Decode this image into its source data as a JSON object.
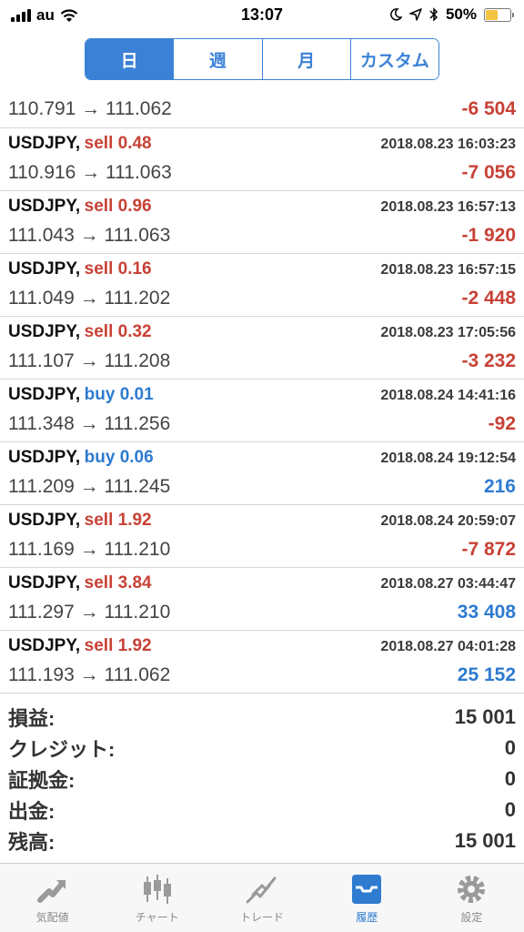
{
  "status_bar": {
    "carrier": "au",
    "time": "13:07",
    "battery_percent": "50%",
    "battery_level": 0.5,
    "colors": {
      "battery": "#f4c542"
    }
  },
  "period_tabs": [
    {
      "label": "日",
      "active": true
    },
    {
      "label": "週",
      "active": false
    },
    {
      "label": "月",
      "active": false
    },
    {
      "label": "カスタム",
      "active": false
    }
  ],
  "partial_row": {
    "prices": "110.791 → 111.062",
    "profit": "-6 504"
  },
  "trades": [
    {
      "symbol": "USDJPY,",
      "side": "sell 0.48",
      "type": "sell",
      "time": "2018.08.23 16:03:23",
      "prices": "110.916 → 111.063",
      "profit": "-7 056",
      "profit_sign": "neg"
    },
    {
      "symbol": "USDJPY,",
      "side": "sell 0.96",
      "type": "sell",
      "time": "2018.08.23 16:57:13",
      "prices": "111.043 → 111.063",
      "profit": "-1 920",
      "profit_sign": "neg"
    },
    {
      "symbol": "USDJPY,",
      "side": "sell 0.16",
      "type": "sell",
      "time": "2018.08.23 16:57:15",
      "prices": "111.049 → 111.202",
      "profit": "-2 448",
      "profit_sign": "neg"
    },
    {
      "symbol": "USDJPY,",
      "side": "sell 0.32",
      "type": "sell",
      "time": "2018.08.23 17:05:56",
      "prices": "111.107 → 111.208",
      "profit": "-3 232",
      "profit_sign": "neg"
    },
    {
      "symbol": "USDJPY,",
      "side": "buy 0.01",
      "type": "buy",
      "time": "2018.08.24 14:41:16",
      "prices": "111.348 → 111.256",
      "profit": "-92",
      "profit_sign": "neg"
    },
    {
      "symbol": "USDJPY,",
      "side": "buy 0.06",
      "type": "buy",
      "time": "2018.08.24 19:12:54",
      "prices": "111.209 → 111.245",
      "profit": "216",
      "profit_sign": "pos"
    },
    {
      "symbol": "USDJPY,",
      "side": "sell 1.92",
      "type": "sell",
      "time": "2018.08.24 20:59:07",
      "prices": "111.169 → 111.210",
      "profit": "-7 872",
      "profit_sign": "neg"
    },
    {
      "symbol": "USDJPY,",
      "side": "sell 3.84",
      "type": "sell",
      "time": "2018.08.27 03:44:47",
      "prices": "111.297 → 111.210",
      "profit": "33 408",
      "profit_sign": "pos"
    },
    {
      "symbol": "USDJPY,",
      "side": "sell 1.92",
      "type": "sell",
      "time": "2018.08.27 04:01:28",
      "prices": "111.193 → 111.062",
      "profit": "25 152",
      "profit_sign": "pos"
    }
  ],
  "summary": [
    {
      "label": "損益:",
      "value": "15 001"
    },
    {
      "label": "クレジット:",
      "value": "0"
    },
    {
      "label": "証拠金:",
      "value": "0"
    },
    {
      "label": "出金:",
      "value": "0"
    },
    {
      "label": "残高:",
      "value": "15 001"
    }
  ],
  "tabbar": [
    {
      "label": "気配値",
      "icon": "quotes-icon",
      "active": false
    },
    {
      "label": "チャート",
      "icon": "chart-icon",
      "active": false
    },
    {
      "label": "トレード",
      "icon": "trade-icon",
      "active": false
    },
    {
      "label": "履歴",
      "icon": "history-icon",
      "active": true
    },
    {
      "label": "設定",
      "icon": "settings-icon",
      "active": false
    }
  ],
  "colors": {
    "accent": "#3b82d6",
    "loss": "#c84136",
    "gain": "#2e7bd0"
  }
}
